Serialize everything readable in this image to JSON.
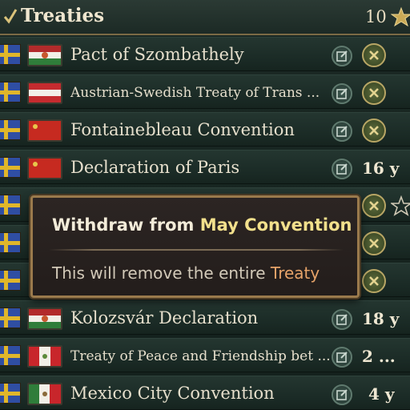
{
  "header": {
    "title": "Treaties",
    "count": "10"
  },
  "colors": {
    "accent_gold": "#b8a665",
    "highlight_yellow": "#f2e08c",
    "highlight_orange": "#e6a369"
  },
  "rows": [
    {
      "name": "Pact of Szombathely",
      "flag": "hungary",
      "years": ""
    },
    {
      "name": "Austrian-Swedish Treaty of Trans ...",
      "flag": "austria",
      "years": ""
    },
    {
      "name": "Fontainebleau Convention",
      "flag": "red",
      "years": ""
    },
    {
      "name": "Declaration of Paris",
      "flag": "red",
      "years": "16 y"
    },
    {
      "name": "",
      "flag": "none",
      "years": ""
    },
    {
      "name": "",
      "flag": "none",
      "years": ""
    },
    {
      "name": "",
      "flag": "none",
      "years": ""
    },
    {
      "name": "Kolozsvár Declaration",
      "flag": "hungary",
      "years": "18 y"
    },
    {
      "name": "Treaty of Peace and Friendship bet ...",
      "flag": "peru",
      "years": "2 ..."
    },
    {
      "name": "Mexico City Convention",
      "flag": "mexico",
      "years": "4 y"
    }
  ],
  "tooltip": {
    "title_prefix": "Withdraw from ",
    "title_highlight": "May Convention",
    "body_prefix": "This will remove the entire ",
    "body_highlight": "Treaty"
  },
  "icons": {
    "edit": "edit-icon",
    "cancel": "cancel-icon",
    "star": "star-icon",
    "check": "check-icon"
  }
}
